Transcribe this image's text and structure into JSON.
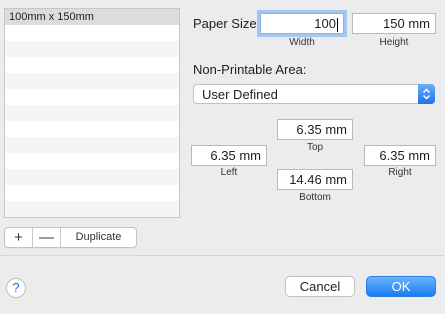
{
  "paper_list": {
    "items": [
      "100mm x 150mm"
    ],
    "selected_index": 0
  },
  "list_controls": {
    "add_label": "+",
    "remove_label": "—",
    "duplicate_label": "Duplicate"
  },
  "paper_size": {
    "label": "Paper Size:",
    "width_value": "100",
    "height_value": "150 mm",
    "width_caption": "Width",
    "height_caption": "Height"
  },
  "non_printable": {
    "label": "Non-Printable Area:",
    "selected_option": "User Defined",
    "top_value": "6.35 mm",
    "top_caption": "Top",
    "left_value": "6.35 mm",
    "left_caption": "Left",
    "right_value": "6.35 mm",
    "right_caption": "Right",
    "bottom_value": "14.46 mm",
    "bottom_caption": "Bottom"
  },
  "footer": {
    "help_label": "?",
    "cancel_label": "Cancel",
    "ok_label": "OK"
  },
  "colors": {
    "accent": "#1d73ee",
    "focus_ring": "#a6c6f2"
  }
}
